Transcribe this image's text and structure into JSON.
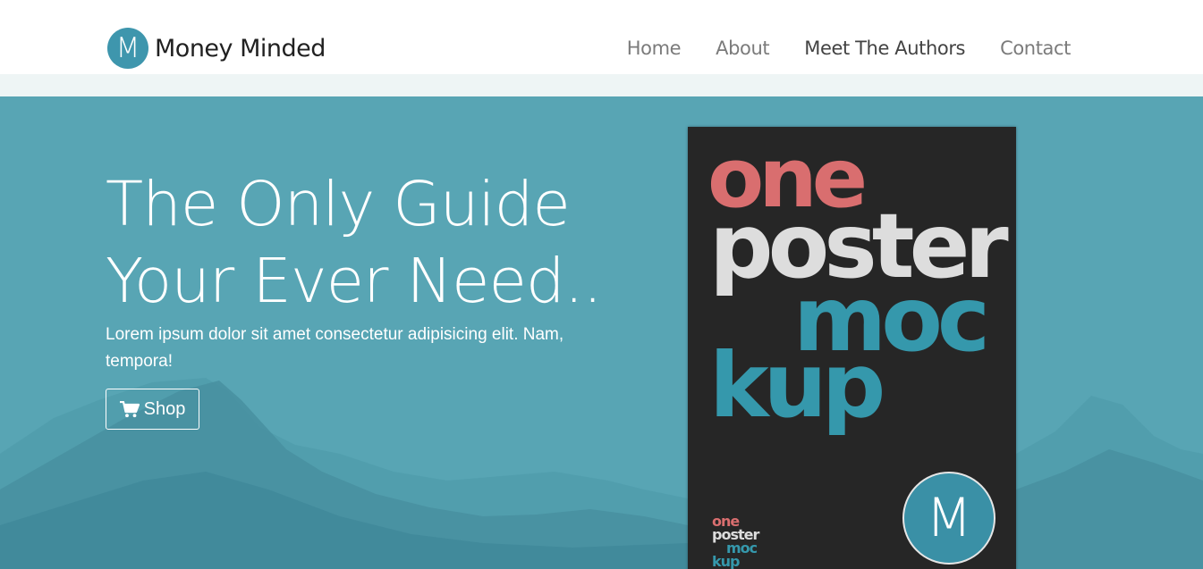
{
  "brand": {
    "logo_letter": "M",
    "name": "Money Minded",
    "color": "#3e96ad"
  },
  "nav": [
    {
      "label": "Home"
    },
    {
      "label": "About"
    },
    {
      "label": "Meet The Authors"
    },
    {
      "label": "Contact"
    }
  ],
  "hero": {
    "title_line1": "The Only Guide",
    "title_line2": "Your Ever Need..",
    "lead": "Lorem ipsum dolor sit amet consectetur adipisicing elit. Nam, tempora!",
    "shop_label": "Shop",
    "shop_icon": "shopping-cart-icon",
    "background_color": "#58a5b4"
  },
  "poster": {
    "word1": "one",
    "word2": "poster",
    "word3": "moc",
    "word4": "kup",
    "mini_word1": "one",
    "mini_word2": "poster",
    "mini_word3": "moc",
    "mini_word4": "kup",
    "mark_letter": "M"
  }
}
